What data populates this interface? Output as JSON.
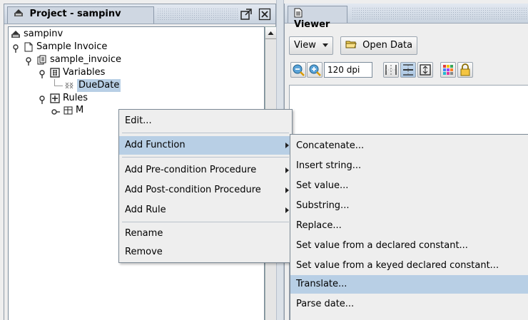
{
  "project_panel": {
    "title": "Project - sampinv",
    "tree": {
      "root": "sampinv",
      "document": "Sample Invoice",
      "schema": "sample_invoice",
      "variables": "Variables",
      "variable_item": "DueDate",
      "rules": "Rules",
      "rule_item": "M"
    }
  },
  "viewer_panel": {
    "title": "Viewer",
    "view_button": "View",
    "open_data_button": "Open Data",
    "zoom_level": "120 dpi"
  },
  "context_menu": {
    "items": [
      {
        "label": "Edit...",
        "submenu": false
      },
      {
        "label": "Add Function",
        "submenu": true
      },
      {
        "label": "Add Pre-condition Procedure",
        "submenu": true
      },
      {
        "label": "Add Post-condition Procedure",
        "submenu": true
      },
      {
        "label": "Add Rule",
        "submenu": true
      },
      {
        "label": "Rename",
        "submenu": false
      },
      {
        "label": "Remove",
        "submenu": false
      }
    ]
  },
  "function_submenu": {
    "items": [
      "Concatenate...",
      "Insert string...",
      "Set value...",
      "Substring...",
      "Replace...",
      "Set value from a declared constant...",
      "Set value from a keyed declared constant...",
      "Translate...",
      "Parse date..."
    ]
  }
}
